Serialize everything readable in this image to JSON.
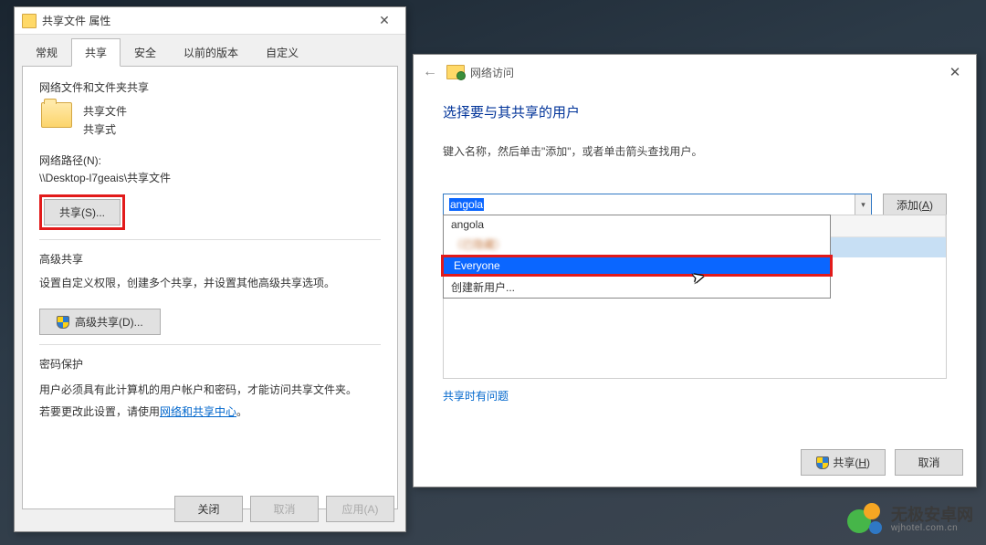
{
  "props": {
    "title": "共享文件 属性",
    "tabs": {
      "general": "常规",
      "share": "共享",
      "security": "安全",
      "previous": "以前的版本",
      "custom": "自定义"
    },
    "group1": {
      "label": "网络文件和文件夹共享",
      "folder_name": "共享文件",
      "status": "共享式",
      "path_label": "网络路径(N):",
      "path_value": "\\\\Desktop-l7geais\\共享文件",
      "share_btn": "共享(S)..."
    },
    "group2": {
      "label": "高级共享",
      "desc": "设置自定义权限，创建多个共享，并设置其他高级共享选项。",
      "btn": "高级共享(D)..."
    },
    "group3": {
      "label": "密码保护",
      "line1": "用户必须具有此计算机的用户帐户和密码，才能访问共享文件夹。",
      "line2_a": "若要更改此设置，请使用",
      "line2_b": "网络和共享中心",
      "line2_c": "。"
    },
    "footer": {
      "close": "关闭",
      "cancel": "取消",
      "apply": "应用(A)"
    }
  },
  "net": {
    "header_title": "网络访问",
    "heading": "选择要与其共享的用户",
    "instruction": "键入名称，然后单击\"添加\"，或者单击箭头查找用户。",
    "input_value": "angola",
    "add_btn": "添加(A)",
    "dropdown": {
      "opt1": "angola",
      "opt_blur": "（已隐藏）",
      "opt2": "Everyone",
      "opt3": "创建新用户..."
    },
    "trouble_link": "共享时有问题",
    "footer": {
      "share": "共享(H)",
      "cancel": "取消"
    }
  },
  "watermark": {
    "main": "无极安卓网",
    "sub": "wjhotel.com.cn"
  }
}
